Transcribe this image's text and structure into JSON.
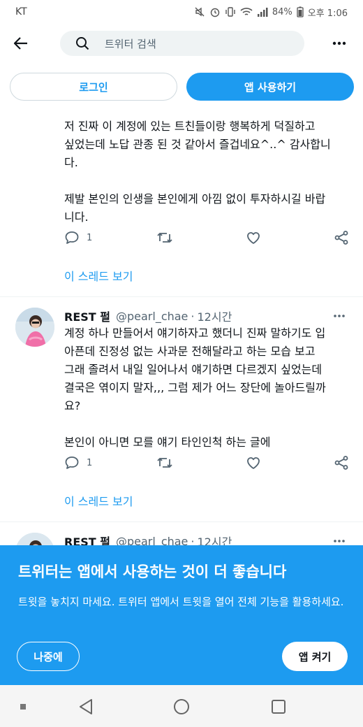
{
  "status_bar": {
    "carrier": "KT",
    "battery": "84%",
    "time": "오후 1:06"
  },
  "top_bar": {
    "search_placeholder": "트위터 검색"
  },
  "auth": {
    "login_label": "로그인",
    "use_app_label": "앱 사용하기"
  },
  "tweet_1": {
    "text": "저 진짜 이 계정에 있는 트친들이랑 행복하게 덕질하고\n싶었는데 노답 관종 된 것 같아서 즐겁네요^..^ 감사합니\n다.\n\n제발 본인의 인생을 본인에게 아낌 없이 투자하시길 바랍\n니다.",
    "reply_count": "1",
    "thread_link": "이 스레드 보기"
  },
  "tweet_2": {
    "name": "REST 펄",
    "handle": "@pearl_chae",
    "separator": "·",
    "time": "12시간",
    "text": "계정 하나 만들어서 얘기하자고 했더니 진짜 말하기도 입\n아픈데 진정성 없는 사과문 전해달라고 하는 모습 보고\n그래 졸려서 내일 일어나서 얘기하면 다르겠지 싶었는데\n결국은 엮이지 말자,,, 그럼 제가 어느 장단에 놀아드릴까\n요?\n\n본인이 아니면 모를 얘기 타인인척 하는 글에",
    "reply_count": "1",
    "thread_link": "이 스레드 보기"
  },
  "tweet_3": {
    "name": "REST 펄",
    "handle": "@pearl_chae",
    "separator": "·",
    "time": "12시간"
  },
  "banner": {
    "title": "트위터는 앱에서 사용하는 것이 더 좋습니다",
    "description": "트윗을 놓치지 마세요. 트위터 앱에서 트윗을 열어 전체 기능을 활용하세요.",
    "later_label": "나중에",
    "open_app_label": "앱 켜기"
  },
  "colors": {
    "accent": "#1d9bf0",
    "text": "#0f1419",
    "muted": "#536471"
  },
  "icons": [
    "back-arrow-icon",
    "search-icon",
    "more-icon",
    "reply-icon",
    "retweet-icon",
    "like-icon",
    "share-icon"
  ]
}
